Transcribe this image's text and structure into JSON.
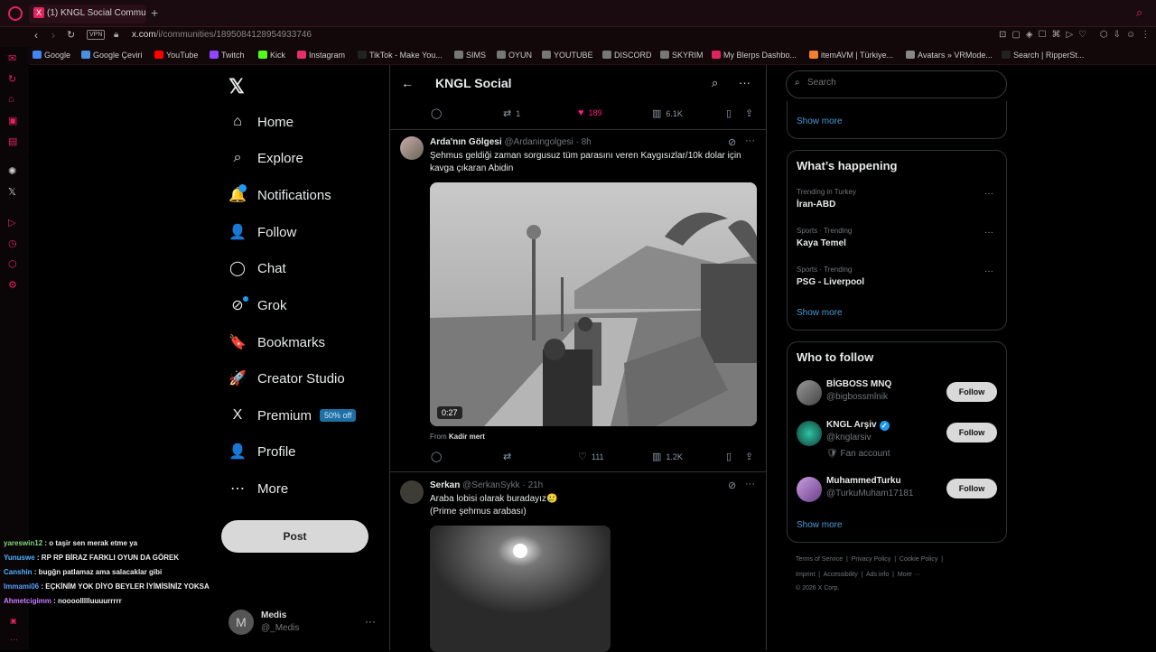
{
  "browser": {
    "tab_title": "(1) KNGL Social Communit",
    "tab_icon": "X",
    "vpn_label": "VPN",
    "url_host": "x.com",
    "url_path": "/i/communities/1895084128954933746",
    "bookmarks": [
      {
        "label": "Google",
        "color": "#4285f4"
      },
      {
        "label": "Google Çeviri",
        "color": "#4a90e2"
      },
      {
        "label": "YouTube",
        "color": "#ff0000"
      },
      {
        "label": "Twitch",
        "color": "#9146ff"
      },
      {
        "label": "Kick",
        "color": "#53fc18"
      },
      {
        "label": "Instagram",
        "color": "#e1306c"
      },
      {
        "label": "TikTok - Make You...",
        "color": "#222222"
      },
      {
        "label": "SIMS",
        "color": "#777777"
      },
      {
        "label": "OYUN",
        "color": "#777777"
      },
      {
        "label": "YOUTUBE",
        "color": "#777777"
      },
      {
        "label": "DISCORD",
        "color": "#777777"
      },
      {
        "label": "SKYRIM",
        "color": "#777777"
      },
      {
        "label": "My Blerps Dashbo...",
        "color": "#e0245e"
      },
      {
        "label": "itemAVM | Türkiye...",
        "color": "#f08030"
      },
      {
        "label": "Avatars » VRMode...",
        "color": "#888888"
      },
      {
        "label": "Search | RipperSt...",
        "color": "#222222"
      }
    ]
  },
  "nav": {
    "items": [
      {
        "label": "Home",
        "icon": "⌂"
      },
      {
        "label": "Explore",
        "icon": "⌕"
      },
      {
        "label": "Notifications",
        "icon": "🔔"
      },
      {
        "label": "Follow",
        "icon": "👤"
      },
      {
        "label": "Chat",
        "icon": "◯"
      },
      {
        "label": "Grok",
        "icon": "⊘"
      },
      {
        "label": "Bookmarks",
        "icon": "🔖"
      },
      {
        "label": "Creator Studio",
        "icon": "🚀"
      },
      {
        "label": "Premium",
        "icon": "X"
      },
      {
        "label": "Profile",
        "icon": "👤"
      },
      {
        "label": "More",
        "icon": "⋯"
      }
    ],
    "premium_badge": "50% off",
    "post_label": "Post",
    "account": {
      "initial": "M",
      "name": "Medis",
      "handle": "@_Medis"
    }
  },
  "chat_overlay": [
    {
      "user": "yareswin12",
      "color": "#7dd87d",
      "text": ": o taşir sen merak etme ya"
    },
    {
      "user": "Yunuswe",
      "color": "#4fb3ff",
      "text": ": RP RP BİRAZ FARKLI OYUN DA GÖREK"
    },
    {
      "user": "Canshin",
      "color": "#4fb3ff",
      "text": ": bugğn patlamaz ama salacaklar gibi"
    },
    {
      "user": "Immami06",
      "color": "#5aa0ff",
      "text": ": EÇKİNİM YOK DİYO BEYLER İYİMİSİNİZ YOKSA"
    },
    {
      "user": "Ahmetcigimm",
      "color": "#c77dff",
      "text": ": noooollllluuuurrrrr"
    }
  ],
  "header": {
    "title": "KNGL Social"
  },
  "top_actions": {
    "replies": "",
    "reposts": "1",
    "likes": "189",
    "views": "6.1K"
  },
  "tweets": [
    {
      "name": "Arda'nın Gölgesi",
      "handle": "@Ardaningolgesi",
      "time": "8h",
      "text": "Şehmus geldiği zaman sorgusuz tüm parasını veren Kaygısızlar/10k dolar için kavga çıkaran Abidin",
      "duration": "0:27",
      "from_label": "From",
      "from_user": "Kadir mert",
      "replies": "",
      "reposts": "",
      "likes": "111",
      "views": "1.2K"
    },
    {
      "name": "Serkan",
      "handle": "@SerkanSykk",
      "time": "21h",
      "text_line1": "Araba lobisi olarak buradayız🥲",
      "text_line2": "(Prime şehmus arabası)"
    }
  ],
  "right": {
    "search_placeholder": "Search",
    "show_more": "Show more",
    "happening_title": "What’s happening",
    "trends": [
      {
        "category": "Trending in Turkey",
        "name": "İran-ABD"
      },
      {
        "category": "Sports · Trending",
        "name": "Kaya Temel"
      },
      {
        "category": "Sports · Trending",
        "name": "PSG - Liverpool"
      }
    ],
    "wtf_title": "Who to follow",
    "wtf": [
      {
        "name": "BİGBOSS MNQ",
        "handle": "@bigbossmlnik",
        "extra": "",
        "verified": false,
        "follow": "Follow"
      },
      {
        "name": "KNGL Arşiv",
        "handle": "@knglarsiv",
        "extra": "🛡 Fan account",
        "verified": true,
        "follow": "Follow"
      },
      {
        "name": "MuhammedTurku",
        "handle": "@TurkuMuham17181",
        "extra": "",
        "verified": false,
        "follow": "Follow"
      }
    ],
    "footer_line1": [
      "Terms of Service",
      "Privacy Policy",
      "Cookie Policy"
    ],
    "footer_line2": [
      "Imprint",
      "Accessibility",
      "Ads info",
      "More ···"
    ],
    "copyright": "© 2026 X Corp."
  }
}
